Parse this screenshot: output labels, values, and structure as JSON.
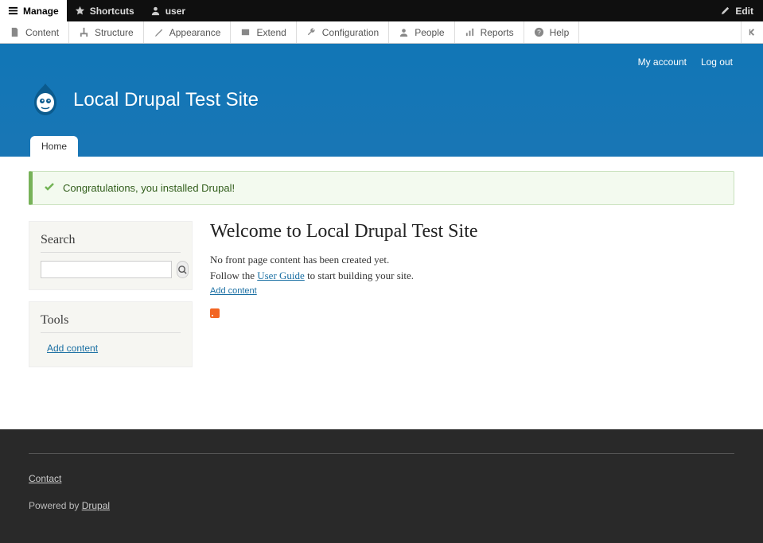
{
  "toolbar": {
    "manage": "Manage",
    "shortcuts": "Shortcuts",
    "user": "user",
    "edit": "Edit"
  },
  "admin": {
    "content": "Content",
    "structure": "Structure",
    "appearance": "Appearance",
    "extend": "Extend",
    "configuration": "Configuration",
    "people": "People",
    "reports": "Reports",
    "help": "Help"
  },
  "userlinks": {
    "account": "My account",
    "logout": "Log out"
  },
  "site_title": "Local Drupal Test Site",
  "tabs": {
    "home": "Home"
  },
  "status_message": "Congratulations, you installed Drupal!",
  "sidebar": {
    "search_heading": "Search",
    "search_value": "",
    "tools_heading": "Tools",
    "tools_add_content": "Add content"
  },
  "main": {
    "title": "Welcome to Local Drupal Test Site",
    "line1": "No front page content has been created yet.",
    "line2_prefix": "Follow the ",
    "line2_link": "User Guide",
    "line2_suffix": " to start building your site.",
    "add_content": "Add content"
  },
  "footer": {
    "contact": "Contact",
    "powered_prefix": "Powered by ",
    "powered_link": "Drupal"
  }
}
